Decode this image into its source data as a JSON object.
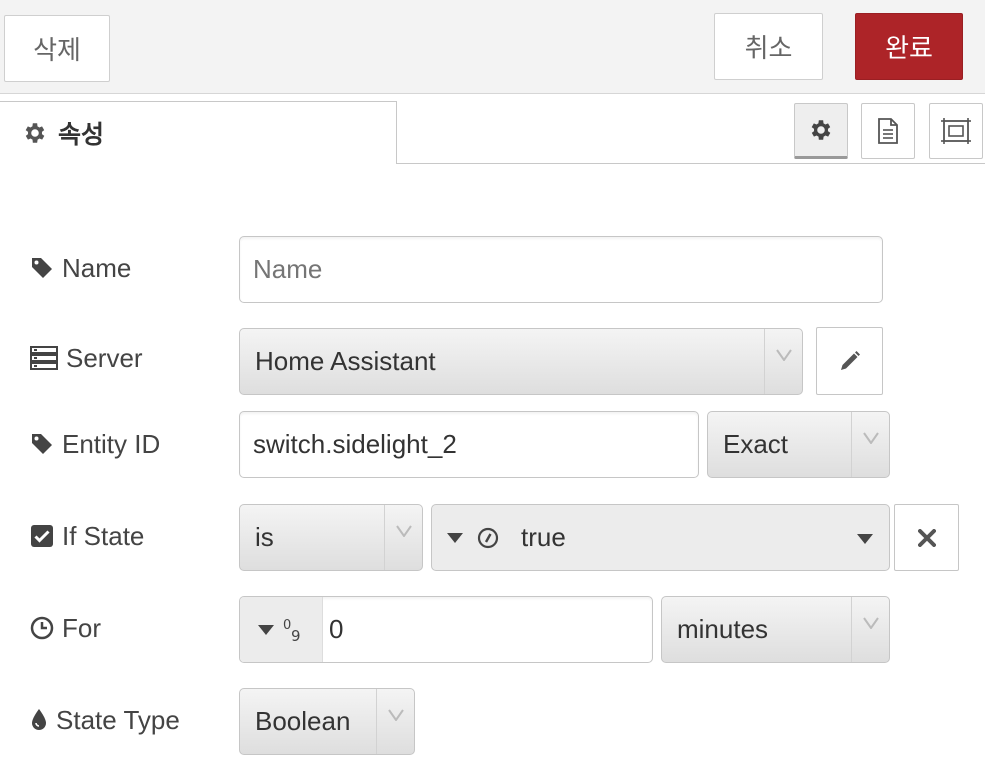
{
  "toolbar": {
    "delete_label": "삭제",
    "cancel_label": "취소",
    "done_label": "완료"
  },
  "tabs": {
    "properties_label": "속성",
    "icons": [
      "gear-icon",
      "document-icon",
      "frame-icon"
    ]
  },
  "form": {
    "name": {
      "label": "Name",
      "placeholder": "Name",
      "value": ""
    },
    "server": {
      "label": "Server",
      "value": "Home Assistant"
    },
    "entity_id": {
      "label": "Entity ID",
      "value": "switch.sidelight_2",
      "match": "Exact"
    },
    "if_state": {
      "label": "If State",
      "operator": "is",
      "value": "true"
    },
    "for": {
      "label": "For",
      "value": "0",
      "unit": "minutes"
    },
    "state_type": {
      "label": "State Type",
      "value": "Boolean"
    }
  },
  "colors": {
    "accent": "#ad2428",
    "toolbar_bg": "#f3f3f3"
  }
}
